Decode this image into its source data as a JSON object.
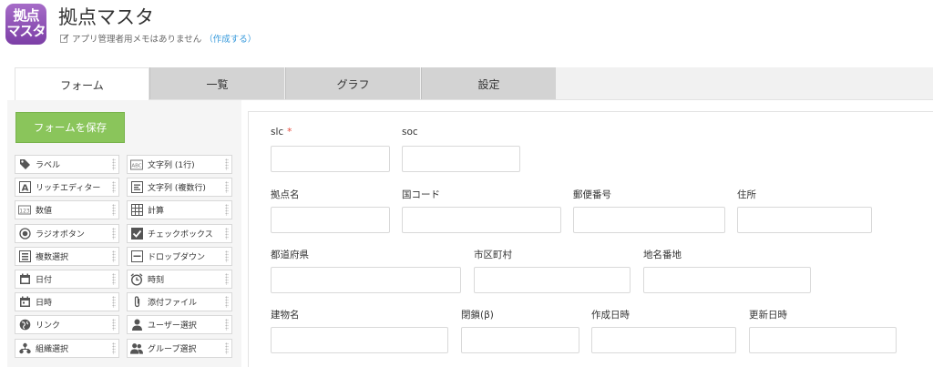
{
  "app": {
    "icon_line1": "拠点",
    "icon_line2": "マスタ",
    "title": "拠点マスタ",
    "memo_text": "アプリ管理者用メモはありません",
    "memo_link": "（作成する）"
  },
  "tabs": [
    {
      "label": "フォーム",
      "active": true
    },
    {
      "label": "一覧",
      "active": false
    },
    {
      "label": "グラフ",
      "active": false
    },
    {
      "label": "設定",
      "active": false
    }
  ],
  "palette": {
    "save_label": "フォームを保存",
    "items_left": [
      "ラベル",
      "リッチエディター",
      "数値",
      "ラジオボタン",
      "複数選択",
      "日付",
      "日時",
      "リンク",
      "組織選択"
    ],
    "items_right": [
      "文字列 (1行)",
      "文字列 (複数行)",
      "計算",
      "チェックボックス",
      "ドロップダウン",
      "時刻",
      "添付ファイル",
      "ユーザー選択",
      "グループ選択"
    ],
    "icons_left": [
      "tag-icon",
      "rich-text-icon",
      "number-icon",
      "radio-icon",
      "multi-select-icon",
      "date-icon",
      "datetime-icon",
      "link-globe-icon",
      "org-icon"
    ],
    "icons_right": [
      "single-line-text-icon",
      "multi-line-text-icon",
      "calc-icon",
      "checkbox-icon",
      "dropdown-icon",
      "clock-icon",
      "attachment-icon",
      "user-icon",
      "group-icon"
    ]
  },
  "form": {
    "required_mark": "*",
    "fields": [
      {
        "label": "slc",
        "required": true
      },
      {
        "label": "soc",
        "required": false
      },
      {
        "label": "拠点名",
        "required": false
      },
      {
        "label": "国コード",
        "required": false
      },
      {
        "label": "郵便番号",
        "required": false
      },
      {
        "label": "住所",
        "required": false
      },
      {
        "label": "都道府県",
        "required": false
      },
      {
        "label": "市区町村",
        "required": false
      },
      {
        "label": "地名番地",
        "required": false
      },
      {
        "label": "建物名",
        "required": false
      },
      {
        "label": "閉鎖(β)",
        "required": false
      },
      {
        "label": "作成日時",
        "required": false
      },
      {
        "label": "更新日時",
        "required": false
      }
    ]
  },
  "colors": {
    "app_icon": "#8b4fb4",
    "save_button": "#8ac55b",
    "required": "#e74c3c",
    "link": "#3498db"
  }
}
